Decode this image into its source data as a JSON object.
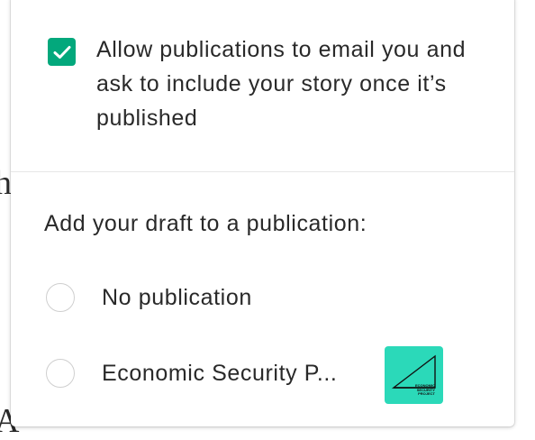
{
  "background": {
    "glyph_top": "h",
    "glyph_bottom": "A"
  },
  "allow_emails": {
    "checked": true,
    "label": "Allow publications to email you and ask to include your story once it’s published",
    "accent_color": "#03a87c"
  },
  "publication": {
    "heading": "Add your draft to a publication:",
    "options": [
      {
        "label": "No publication",
        "selected": false
      },
      {
        "label": "Economic Security P...",
        "selected": false,
        "logo_text": "ECONOMIC SECURITY PROJECT",
        "logo_color": "#2bd9b9"
      }
    ]
  }
}
